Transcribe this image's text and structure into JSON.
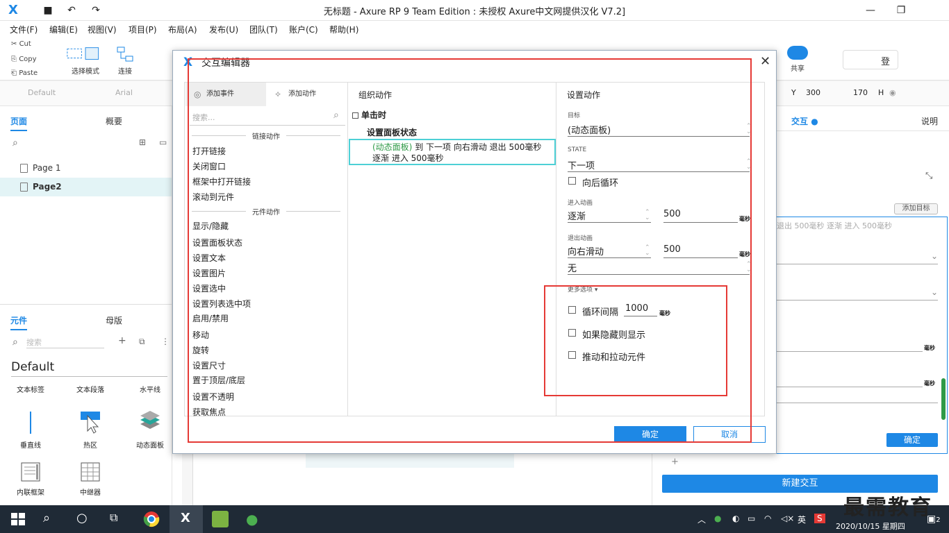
{
  "window": {
    "title": "无标题 - Axure RP 9 Team Edition : 未授权    Axure中文网提供汉化 V7.2]"
  },
  "menu": [
    "文件(F)",
    "编辑(E)",
    "视图(V)",
    "项目(P)",
    "布局(A)",
    "发布(U)",
    "团队(T)",
    "账户(C)",
    "帮助(H)"
  ],
  "toolbar": {
    "cut": "Cut",
    "copy": "Copy",
    "paste": "Paste",
    "select_mode": "选择模式",
    "connect": "连接",
    "share": "共享",
    "login": "登"
  },
  "stylebar": {
    "style": "Default",
    "font": "Arial",
    "y_label": "Y",
    "y_value": "300",
    "h_label": "H",
    "h_value": "170"
  },
  "left_panel": {
    "tabs": [
      "页面",
      "概要"
    ],
    "pages": [
      "Page 1",
      "Page2"
    ],
    "lib_tabs": [
      "元件",
      "母版"
    ],
    "lib_search_placeholder": "搜索",
    "library": "Default",
    "widgets": [
      "文本标签",
      "文本段落",
      "水平线",
      "垂直线",
      "热区",
      "动态面板",
      "内联框架",
      "中继器"
    ]
  },
  "right_panel": {
    "tab_interaction": "交互",
    "tab_notes": "说明",
    "add_target": "添加目标",
    "summary": "退出 500毫秒 逐渐 进入 500毫秒",
    "unit": "毫秒",
    "ok": "确定",
    "new_interaction": "新建交互"
  },
  "dialog": {
    "title": "交互编辑器",
    "tab_add_event": "添加事件",
    "tab_add_action": "添加动作",
    "search_placeholder": "搜索...",
    "section_link": "链接动作",
    "link_actions": [
      "打开链接",
      "关闭窗口",
      "框架中打开链接",
      "滚动到元件"
    ],
    "section_widget": "元件动作",
    "widget_actions": [
      "显示/隐藏",
      "设置面板状态",
      "设置文本",
      "设置图片",
      "设置选中",
      "设置列表选中项",
      "启用/禁用",
      "移动",
      "旋转",
      "设置尺寸",
      "置于顶层/底层",
      "设置不透明",
      "获取焦点"
    ],
    "organize_title": "组织动作",
    "event": "单击时",
    "action": "设置面板状态",
    "action_target": "(动态面板)",
    "action_detail_line1": " 到 下一项 向右滑动 退出 500毫秒",
    "action_detail_line2": "逐渐 进入 500毫秒",
    "settings_title": "设置动作",
    "target_label": "目标",
    "target_value": "(动态面板)",
    "state_label": "STATE",
    "state_value": "下一项",
    "wrap_label": "向后循环",
    "enter_label": "进入动画",
    "enter_anim": "逐渐",
    "enter_time": "500",
    "exit_label": "退出动画",
    "exit_anim": "向右滑动",
    "exit_time": "500",
    "easing": "无",
    "unit": "毫秒",
    "more_options": "更多选项",
    "loop_label": "循环间隔",
    "loop_value": "1000",
    "show_if_hidden": "如果隐藏则显示",
    "push_pull": "推动和拉动元件",
    "ok": "确定",
    "cancel": "取消"
  },
  "taskbar": {
    "ime": "英",
    "datetime": "2020/10/15 星期四",
    "notifications": "2"
  },
  "watermark": "最需教育"
}
